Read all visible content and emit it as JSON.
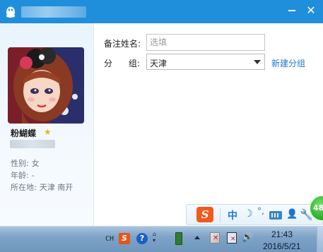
{
  "window": {
    "minimize_label": "",
    "close_label": "✕"
  },
  "profile": {
    "nickname": "粉蝴蝶",
    "gender_label": "性别:",
    "gender": "女",
    "age_label": "年龄:",
    "age": "-",
    "location_label": "所在地:",
    "location": "天津  南开"
  },
  "form": {
    "remark_label": "备注姓名:",
    "remark_placeholder": "选填",
    "remark_value": "",
    "group_label": "分      组:",
    "group_value": "天津",
    "new_group_link": "新建分组"
  },
  "ime_toolbar": {
    "logo": "S",
    "lang": "中",
    "moon": "☽",
    "punct": "°,"
  },
  "speed_badge": "48",
  "taskbar": {
    "lang": "CH",
    "sogou": "S",
    "help": "?",
    "options": "♢\n▾",
    "time": "21:43",
    "date": "2016/5/21"
  },
  "colors": {
    "titlebar": "#1f8fdc",
    "link": "#1b79d0",
    "taskbar": "#7fa3c8"
  }
}
